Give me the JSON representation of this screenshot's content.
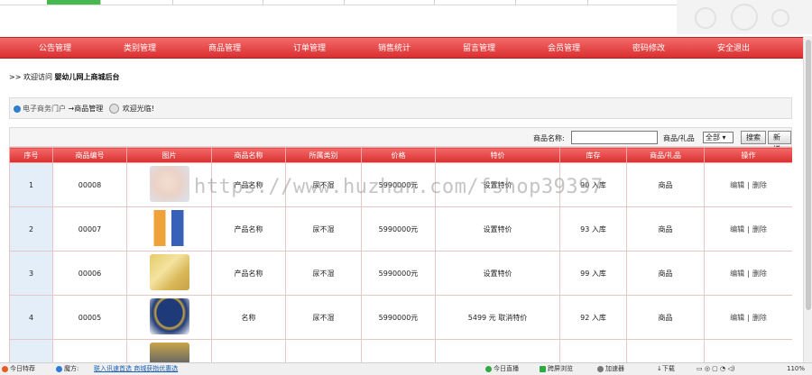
{
  "nav": {
    "items": [
      "公告管理",
      "类别管理",
      "商品管理",
      "订单管理",
      "销售统计",
      "留言管理",
      "会员管理",
      "密码修改",
      "安全退出"
    ]
  },
  "welcome": {
    "prefix": ">> 欢迎访问",
    "site": "婴幼儿网上商城后台"
  },
  "breadcrumb": {
    "home": "电子商务门户",
    "current": "→商品管理",
    "greet": "欢迎光临!"
  },
  "search": {
    "name_label": "商品名称:",
    "name_value": "",
    "type_label": "商品/礼品",
    "type_selected": "全部",
    "search_button": "搜索",
    "add_button": "新增"
  },
  "table": {
    "headers": [
      "序号",
      "商品编号",
      "图片",
      "商品名称",
      "所属类别",
      "价格",
      "特价",
      "库存",
      "商品/礼品",
      "操作"
    ],
    "rows": [
      {
        "idx": "1",
        "code": "00008",
        "name": "产品名称",
        "category": "尿不湿",
        "price": "5990000元",
        "special": "设置特价",
        "stock": "90 入库",
        "kind": "商品",
        "edit": "编辑",
        "delete": "删除"
      },
      {
        "idx": "2",
        "code": "00007",
        "name": "产品名称",
        "category": "尿不湿",
        "price": "5990000元",
        "special": "设置特价",
        "stock": "93 入库",
        "kind": "商品",
        "edit": "编辑",
        "delete": "删除"
      },
      {
        "idx": "3",
        "code": "00006",
        "name": "产品名称",
        "category": "尿不湿",
        "price": "5990000元",
        "special": "设置特价",
        "stock": "99 入库",
        "kind": "商品",
        "edit": "编辑",
        "delete": "删除"
      },
      {
        "idx": "4",
        "code": "00005",
        "name": "名称",
        "category": "尿不湿",
        "price": "5990000元",
        "special": "5499 元  取消特价",
        "stock": "92 入库",
        "kind": "商品",
        "edit": "编辑",
        "delete": "删除"
      }
    ]
  },
  "watermark": "https://www.huzhan.com/fshop39397",
  "statusbar": {
    "left1": "今日特荐",
    "left2": "魔方:",
    "left3": "联入讯速首选 商城获指优惠选",
    "r1": "今日直播",
    "r2": "跨屏浏览",
    "r3": "加速器",
    "r4": "下载",
    "r5": "110%"
  },
  "colors": {
    "nav_red": "#da2f30",
    "index_blue": "#e4eef8"
  }
}
